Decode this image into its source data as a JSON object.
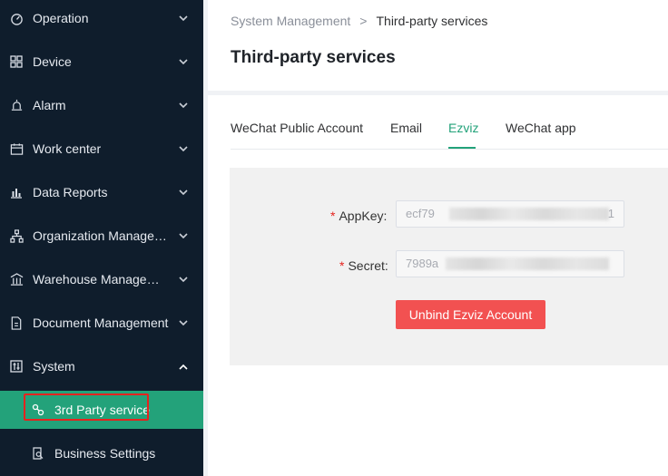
{
  "sidebar": {
    "items": [
      {
        "label": "Operation",
        "icon": "dashboard-icon",
        "expanded": false
      },
      {
        "label": "Device",
        "icon": "grid-icon",
        "expanded": false
      },
      {
        "label": "Alarm",
        "icon": "alarm-icon",
        "expanded": false
      },
      {
        "label": "Work center",
        "icon": "calendar-icon",
        "expanded": false
      },
      {
        "label": "Data Reports",
        "icon": "bar-chart-icon",
        "expanded": false
      },
      {
        "label": "Organization Management",
        "icon": "org-tree-icon",
        "expanded": false
      },
      {
        "label": "Warehouse Management",
        "icon": "warehouse-icon",
        "expanded": false
      },
      {
        "label": "Document Management",
        "icon": "document-icon",
        "expanded": false
      },
      {
        "label": "System",
        "icon": "system-settings-icon",
        "expanded": true
      }
    ],
    "sub_items": [
      {
        "label": "3rd Party service",
        "icon": "link-icon",
        "active": true
      },
      {
        "label": "Business Settings",
        "icon": "search-settings-icon",
        "active": false
      }
    ],
    "colors": {
      "background": "#0f1d2c",
      "active": "#23a27a",
      "highlight": "#e5231e"
    }
  },
  "breadcrumb": {
    "parent": "System Management",
    "separator": ">",
    "current": "Third-party services"
  },
  "page_title": "Third-party services",
  "tabs": [
    {
      "label": "WeChat Public Account",
      "active": false
    },
    {
      "label": "Email",
      "active": false
    },
    {
      "label": "Ezviz",
      "active": true
    },
    {
      "label": "WeChat app",
      "active": false
    }
  ],
  "form": {
    "appkey": {
      "required_mark": "*",
      "label": "AppKey:",
      "value_prefix": "ecf79",
      "value_suffix": "1"
    },
    "secret": {
      "required_mark": "*",
      "label": "Secret:",
      "value_prefix": "7989a"
    },
    "unbind_button": "Unbind Ezviz Account"
  },
  "colors": {
    "accent": "#23a27a",
    "danger": "#f25151"
  }
}
